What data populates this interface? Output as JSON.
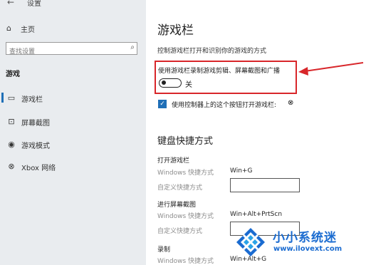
{
  "window": {
    "back_glyph": "←",
    "title": "设置"
  },
  "sidebar": {
    "home_label": "主页",
    "search_placeholder": "查找设置",
    "category": "游戏",
    "items": [
      {
        "label": "游戏栏",
        "icon": "game-bar-icon",
        "active": true
      },
      {
        "label": "屏幕截图",
        "icon": "screenshot-icon",
        "active": false
      },
      {
        "label": "游戏模式",
        "icon": "game-mode-icon",
        "active": false
      },
      {
        "label": "Xbox 网络",
        "icon": "xbox-icon",
        "active": false
      }
    ]
  },
  "main": {
    "title": "游戏栏",
    "description": "控制游戏栏打开和识别你的游戏的方式",
    "record_setting": {
      "label": "使用游戏栏录制游戏剪辑、屏幕截图和广播",
      "state": "关",
      "on": false
    },
    "controller_setting": {
      "label": "使用控制器上的这个按钮打开游戏栏:",
      "checked": true
    },
    "shortcuts_title": "键盘快捷方式",
    "groups": [
      {
        "title": "打开游戏栏",
        "windows_label": "Windows 快捷方式",
        "windows_value": "Win+G",
        "custom_label": "自定义快捷方式",
        "custom_value": ""
      },
      {
        "title": "进行屏幕截图",
        "windows_label": "Windows 快捷方式",
        "windows_value": "Win+Alt+PrtScn",
        "custom_label": "自定义快捷方式",
        "custom_value": ""
      },
      {
        "title": "录制",
        "windows_label": "Windows 快捷方式",
        "windows_value": "Win+Alt+G"
      }
    ]
  },
  "annotation": {
    "color": "#d8262a"
  },
  "watermark": {
    "title": "小小系统迷",
    "url": "www.ilovext.com"
  },
  "colors": {
    "accent": "#1f6fb7",
    "sidebar_bg": "#e9ecef",
    "watermark": "#1a6bd0"
  }
}
